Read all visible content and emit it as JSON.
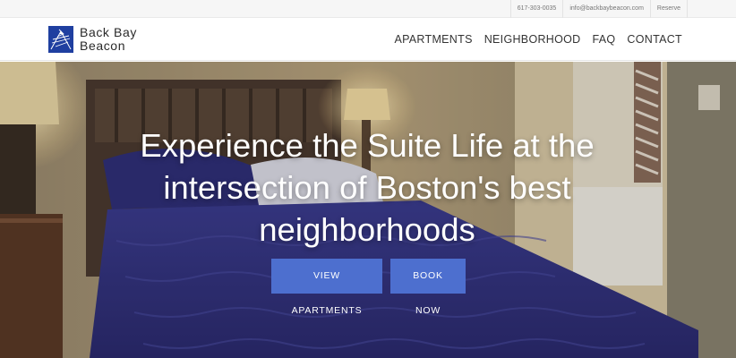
{
  "topbar": {
    "phone": "617-303-0035",
    "email": "info@backbaybeacon.com",
    "reserve": "Reserve"
  },
  "brand": {
    "line1": "Back Bay",
    "line2": "Beacon",
    "logo_icon": "beacon-logo-icon",
    "logo_color": "#1f3fa0"
  },
  "nav": {
    "items": [
      {
        "label": "APARTMENTS"
      },
      {
        "label": "NEIGHBORHOOD"
      },
      {
        "label": "FAQ"
      },
      {
        "label": "CONTACT"
      }
    ]
  },
  "hero": {
    "title": "Experience the Suite Life at the intersection of Boston's best neighborhoods",
    "primary_button": "VIEW APARTMENTS",
    "secondary_button": "BOOK NOW",
    "button_color": "#4d6fcf"
  }
}
